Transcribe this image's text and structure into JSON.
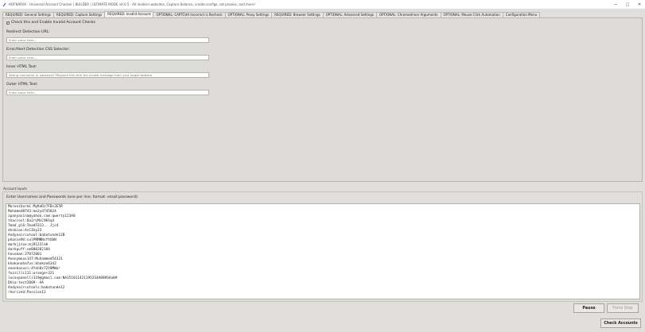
{
  "window": {
    "title": "HOFNAR00 - Universal Account Checker | BUILDER | ULTIMATE MODE v6.0.5 - All modern websites, Capture Balance, create configs, set proxies, and more!",
    "controls": [
      "—",
      "□",
      "✕"
    ]
  },
  "tabs": [
    "REQUIRED: General Settings",
    "REQUIRED: Capture Settings",
    "REQUIRED: Invalid Account",
    "OPTIONAL: CAPTCHA Incorrect is Recheck",
    "OPTIONAL: Proxy Settings",
    "REQUIRED: Browser Settings",
    "OPTIONAL: Advanced Settings",
    "OPTIONAL: Chromedriver Arguments",
    "OPTIONAL: Mouse Click Automation",
    "Configuration Menu"
  ],
  "active_tab_index": 2,
  "invalid_panel": {
    "check_label": "Check this and Enable Invalid Account Checks",
    "checked": true,
    "redirect_label": "Redirect Detection URL:",
    "redirect_placeholder": "Enter value here...",
    "css_label": "Error/Alert Detection CSS Selector:",
    "css_placeholder": "Enter value here...",
    "inner_label": "Inner HTML Text:",
    "inner_placeholder": "Wrong username or password *Replace this with the invalid message from your target website",
    "outer_label": "Outer HTML Text:",
    "outer_placeholder": "Enter value here..."
  },
  "account_inputs": {
    "section_label": "Account Inputs",
    "label": "Enter Usernames and Passwords (one per line, format: email:password):",
    "lines": [
      "Moreniburmi:MyKnRz7FBs3E5R",
      "Muhamed8743:mo2yd745024",
      "zpanyasina@yahoo.com:qwerty123A8",
      "thacrosl:Da2rLMcC9K1q4",
      "Tmad_gl6:Tmad5313.. Jjs4",
      "dnsbion:AcCIky23",
      "Andynaircutool:babatunde12B",
      "phonie9U:culPNMNNsYtUbN",
      "markjjnux:mj8123lab",
      "darkpuff:cm000202184",
      "housman:27072001",
      "Anonymous147:Muhammed54321",
      "khokonahafus:khokon6343",
      "anonkasuzi:4Yoh8z72Y8MWa!",
      "fozzilli111:orange+321",
      "lucaspanelli119@gmail.com:NA1510114211952S4A88#SAa8#",
      "Dhia:test2009--AA",
      "Andynaircutools:babatunde12",
      "rhorized:Passion12"
    ]
  },
  "buttons": {
    "pause": "Pause",
    "force_stop": "Force Stop",
    "check_accounts": "Check Accounts"
  },
  "colors": {
    "background": "#e1dfdb",
    "input_bg": "#ffffff",
    "active_tab": "#f2f1ee"
  }
}
